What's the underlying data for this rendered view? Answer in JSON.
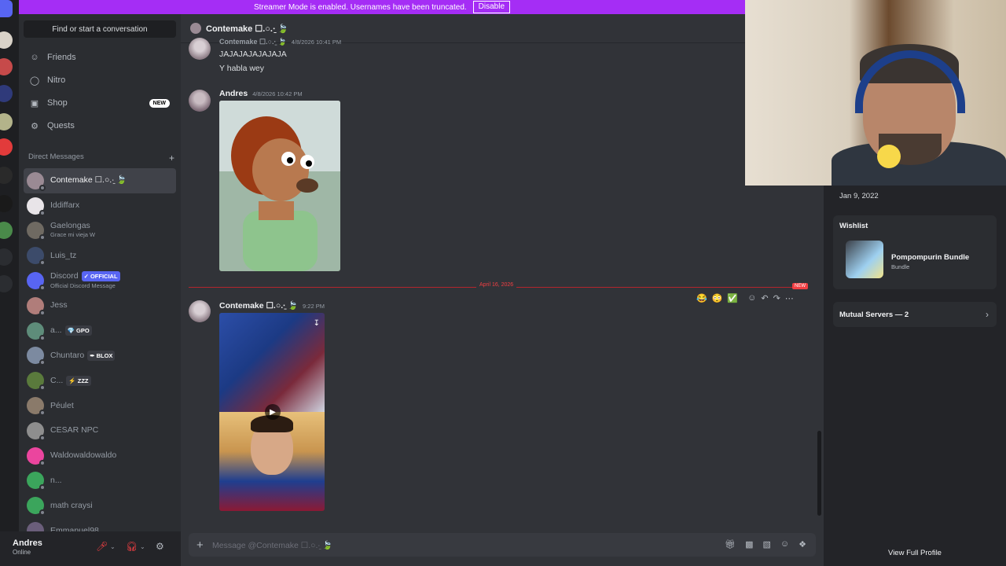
{
  "banner": {
    "text": "Streamer Mode is enabled. Usernames have been truncated.",
    "disable_label": "Disable"
  },
  "sidebar": {
    "find_placeholder": "Find or start a conversation",
    "nav": [
      {
        "label": "Friends",
        "icon": "friends-icon"
      },
      {
        "label": "Nitro",
        "icon": "nitro-icon"
      },
      {
        "label": "Shop",
        "icon": "shop-icon",
        "badge": "NEW"
      },
      {
        "label": "Quests",
        "icon": "quests-icon"
      }
    ],
    "dm_header": "Direct Messages",
    "dms": [
      {
        "name": "Contemake ☐.○.∙̱ 🍃",
        "color": "#9a8a94",
        "active": true
      },
      {
        "name": "Iddiffarx",
        "color": "#e8e4e8"
      },
      {
        "name": "Gaelongas",
        "sub": "Grace mi vieja W",
        "color": "#6f6a62"
      },
      {
        "name": "Luis_tz",
        "color": "#3c4b6a"
      },
      {
        "name": "Discord",
        "sub": "Official Discord Message",
        "tag": "✓ OFFICIAL",
        "tag_color": "#5865f2",
        "color": "#5865f2"
      },
      {
        "name": "Jess",
        "color": "#b07d7a"
      },
      {
        "name": "a...",
        "tag": "💎 GPO",
        "tag_color": "#3a3c43",
        "color": "#5e8c7a"
      },
      {
        "name": "Chuntaro",
        "tag": "✒ BLOX",
        "tag_color": "#3a3c43",
        "color": "#7c8aa0"
      },
      {
        "name": "C...",
        "tag": "⚡ ZZZ",
        "tag_color": "#3a3c43",
        "color": "#5a7a3c"
      },
      {
        "name": "Péulet",
        "color": "#8a7a6a"
      },
      {
        "name": "CESAR NPC",
        "color": "#8e8e8e"
      },
      {
        "name": "Waldowaldowaldo",
        "color": "#eb459e"
      },
      {
        "name": "n...",
        "color": "#3ba55c"
      },
      {
        "name": "math craysi",
        "color": "#3ba55c"
      },
      {
        "name": "Emmanuel98",
        "color": "#6a5e7a"
      }
    ]
  },
  "user_panel": {
    "name": "Andres",
    "status": "Online"
  },
  "chat": {
    "recipient": "Contemake ☐.○.∙̱ 🍃",
    "messages": [
      {
        "author": "Contemake ☐.○.∙̱ 🍃",
        "timestamp": "4/8/2026 10:41 PM",
        "lines": [
          "JAJAJAJAJAJAJA",
          "Y habla wey"
        ]
      },
      {
        "author": "Andres",
        "timestamp": "4/8/2026 10:42 PM"
      },
      {
        "author": "Contemake ☐.○.∙̱ 🍃",
        "timestamp": "9:22 PM"
      }
    ],
    "date_divider": "April 16, 2026",
    "new_badge": "NEW",
    "hover_reactions": [
      "😂",
      "😳",
      "✅"
    ],
    "composer_placeholder": "Message @Contemake ☐.○.∙̱ 🍃"
  },
  "profile": {
    "member_since": "Jan 9, 2022",
    "wishlist_label": "Wishlist",
    "wishlist_item": "Pompompurin Bundle",
    "wishlist_sub": "Bundle",
    "mutual_servers": "Mutual Servers — 2",
    "view_full": "View Full Profile"
  },
  "colors": {
    "accent": "#5865f2",
    "banner": "#a52df5",
    "divider": "#f23f43",
    "online": "#23a55a"
  }
}
